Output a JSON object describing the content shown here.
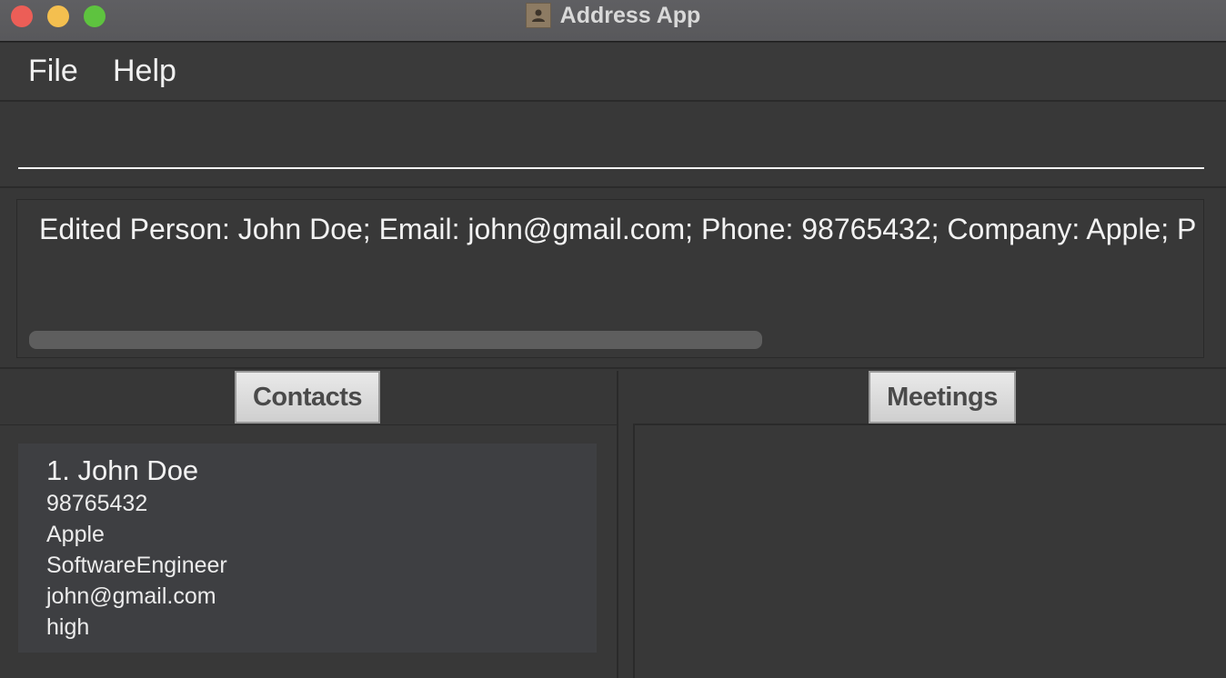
{
  "window": {
    "title": "Address App",
    "app_icon": "address-book-icon"
  },
  "menu": {
    "file": "File",
    "help": "Help"
  },
  "command": {
    "value": "",
    "placeholder": ""
  },
  "result": {
    "text": "Edited Person: John Doe; Email: john@gmail.com; Phone: 98765432; Company: Apple; P"
  },
  "tabs": {
    "contacts": "Contacts",
    "meetings": "Meetings"
  },
  "contacts": [
    {
      "name": "1. John Doe",
      "phone": "98765432",
      "company": "Apple",
      "role": "SoftwareEngineer",
      "email": "john@gmail.com",
      "priority": "high"
    }
  ],
  "meetings": []
}
